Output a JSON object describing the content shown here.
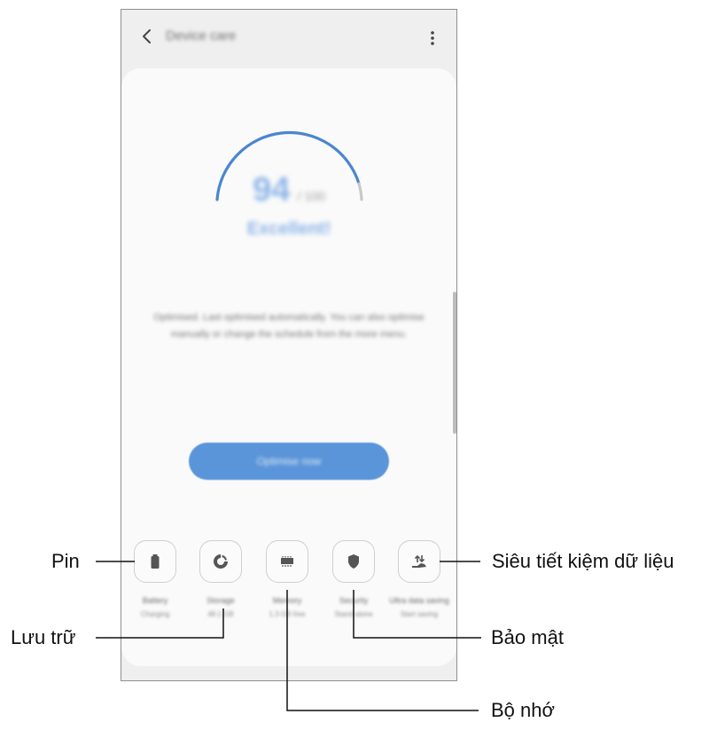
{
  "app": {
    "title": "Device care",
    "back_icon": "back-arrow-icon",
    "more_icon": "more-vertical-icon"
  },
  "score": {
    "value": "94",
    "max": "/ 100",
    "status": "Excellent!",
    "gauge_fill_fraction": 0.94,
    "accent_color": "#4a86d0"
  },
  "description": "Optimised. Last optimised automatically. You can also optimise manually or change the schedule from the more menu.",
  "optimize_button": {
    "label": "Optimise now",
    "color": "#5a95d9"
  },
  "tiles": [
    {
      "icon": "battery-icon",
      "label": "Battery",
      "value": "Charging"
    },
    {
      "icon": "storage-pie-icon",
      "label": "Storage",
      "value": "48.1 GB"
    },
    {
      "icon": "memory-chip-icon",
      "label": "Memory",
      "value": "1.3 GB free"
    },
    {
      "icon": "shield-icon",
      "label": "Security",
      "value": "Stand-alone"
    },
    {
      "icon": "data-saving-icon",
      "label": "Ultra data saving",
      "value": "Start saving"
    }
  ],
  "callouts": {
    "pin": "Pin",
    "luu_tru": "Lưu trữ",
    "bo_nho": "Bộ nhớ",
    "bao_mat": "Bảo mật",
    "sieu_tiet_kiem": "Siêu tiết kiệm dữ liệu"
  }
}
